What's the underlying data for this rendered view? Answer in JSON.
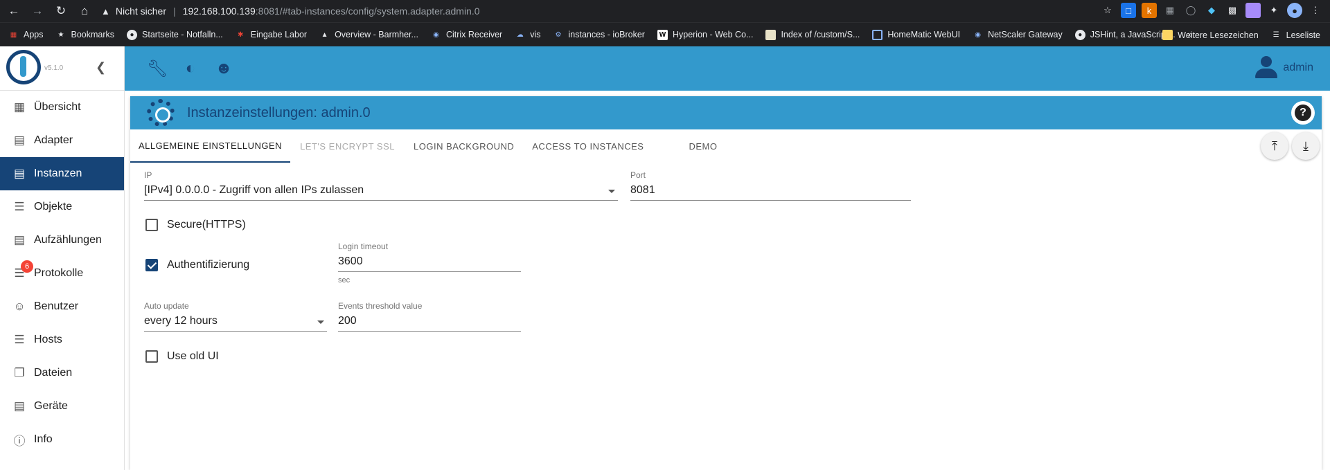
{
  "browser": {
    "security_label": "Nicht sicher",
    "url_host": "192.168.100.139",
    "url_rest": ":8081/#tab-instances/config/system.adapter.admin.0",
    "bookmarks": [
      {
        "label": "Apps",
        "icon": "apps-grid-icon"
      },
      {
        "label": "Bookmarks",
        "icon": "star-icon"
      },
      {
        "label": "Startseite - Notfalln...",
        "icon": "page-icon"
      },
      {
        "label": "Eingabe Labor",
        "icon": "page-icon"
      },
      {
        "label": "Overview - Barmher...",
        "icon": "page-icon"
      },
      {
        "label": "Citrix Receiver",
        "icon": "citrix-icon"
      },
      {
        "label": "vis",
        "icon": "cloud-icon"
      },
      {
        "label": "instances - ioBroker",
        "icon": "iobroker-icon"
      },
      {
        "label": "Hyperion - Web Co...",
        "icon": "hyperion-icon"
      },
      {
        "label": "Index of /custom/S...",
        "icon": "page-icon"
      },
      {
        "label": "HomeMatic WebUI",
        "icon": "homematic-icon"
      },
      {
        "label": "NetScaler Gateway",
        "icon": "citrix-icon"
      },
      {
        "label": "JSHint, a JavaScript...",
        "icon": "page-icon"
      }
    ],
    "more_label": "»",
    "other_bookmarks": "Weitere Lesezeichen",
    "reading_list": "Leseliste"
  },
  "sidebar": {
    "version": "v5.1.0",
    "items": [
      {
        "label": "Übersicht",
        "icon": "apps-grid-icon"
      },
      {
        "label": "Adapter",
        "icon": "store-icon"
      },
      {
        "label": "Instanzen",
        "icon": "instances-icon"
      },
      {
        "label": "Objekte",
        "icon": "list-icon"
      },
      {
        "label": "Aufzählungen",
        "icon": "enum-icon"
      },
      {
        "label": "Protokolle",
        "icon": "log-icon"
      },
      {
        "label": "Benutzer",
        "icon": "user-icon"
      },
      {
        "label": "Hosts",
        "icon": "hosts-icon"
      },
      {
        "label": "Dateien",
        "icon": "files-icon"
      },
      {
        "label": "Geräte",
        "icon": "devices-icon"
      },
      {
        "label": "Info",
        "icon": "info-icon"
      }
    ],
    "log_badge": "6",
    "active": "Instanzen"
  },
  "topbar": {
    "user": "admin"
  },
  "panel": {
    "title": "Instanzeinstellungen: admin.0",
    "tabs": [
      "ALLGEMEINE EINSTELLUNGEN",
      "LET'S ENCRYPT SSL",
      "LOGIN BACKGROUND",
      "ACCESS TO INSTANCES",
      "DEMO"
    ],
    "active_tab": "ALLGEMEINE EINSTELLUNGEN"
  },
  "form": {
    "ip_label": "IP",
    "ip_value": "[IPv4] 0.0.0.0 - Zugriff von allen IPs zulassen",
    "port_label": "Port",
    "port_value": "8081",
    "secure_label": "Secure(HTTPS)",
    "secure_checked": false,
    "auth_label": "Authentifizierung",
    "auth_checked": true,
    "login_timeout_label": "Login timeout",
    "login_timeout_value": "3600",
    "login_timeout_unit": "sec",
    "auto_update_label": "Auto update",
    "auto_update_value": "every 12 hours",
    "events_threshold_label": "Events threshold value",
    "events_threshold_value": "200",
    "old_ui_label": "Use old UI",
    "old_ui_checked": false
  },
  "colors": {
    "primary": "#164477",
    "accent": "#3399cc",
    "badge": "#f44336"
  }
}
